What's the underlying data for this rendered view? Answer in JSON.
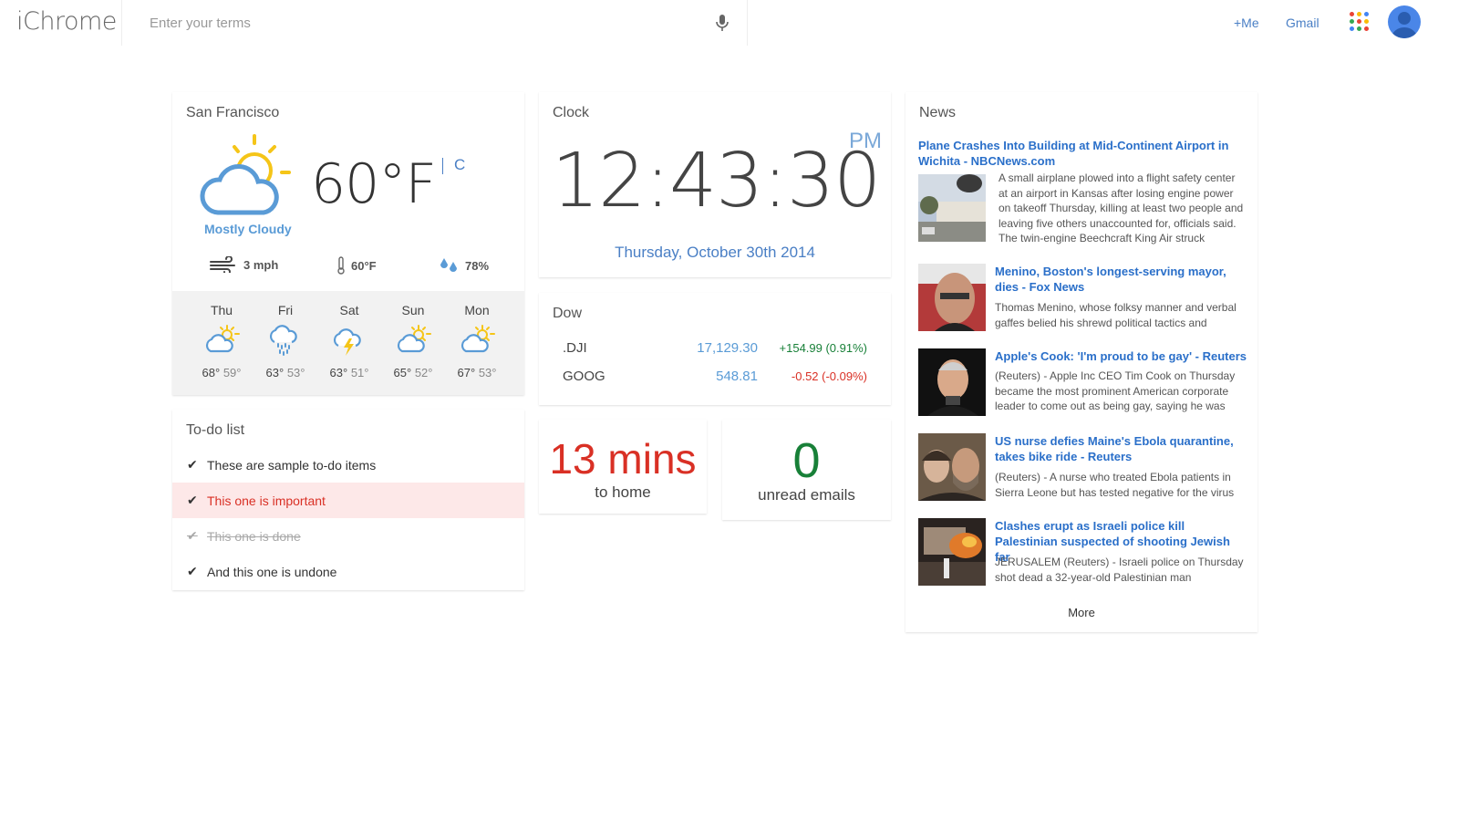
{
  "header": {
    "logo": "iChrome",
    "search_placeholder": "Enter your terms",
    "plus_me": "+Me",
    "gmail": "Gmail"
  },
  "weather": {
    "title": "San Francisco",
    "temp": "60°F",
    "alt_unit": "C",
    "condition": "Mostly Cloudy",
    "wind": "3 mph",
    "feels": "60°F",
    "humidity": "78%",
    "forecast": [
      {
        "day": "Thu",
        "high": "68°",
        "low": "59°",
        "icon": "partly-cloudy-icon"
      },
      {
        "day": "Fri",
        "high": "63°",
        "low": "53°",
        "icon": "rain-icon"
      },
      {
        "day": "Sat",
        "high": "63°",
        "low": "51°",
        "icon": "thunderstorm-icon"
      },
      {
        "day": "Sun",
        "high": "65°",
        "low": "52°",
        "icon": "partly-cloudy-icon"
      },
      {
        "day": "Mon",
        "high": "67°",
        "low": "53°",
        "icon": "partly-cloudy-icon"
      }
    ]
  },
  "todo": {
    "title": "To-do list",
    "items": [
      {
        "text": "These are sample to-do items",
        "state": "normal"
      },
      {
        "text": "This one is important",
        "state": "important"
      },
      {
        "text": "This one is done",
        "state": "done"
      },
      {
        "text": "And this one is undone",
        "state": "normal"
      }
    ]
  },
  "clock": {
    "title": "Clock",
    "time": "12:43:30",
    "ampm": "PM",
    "date": "Thursday, October 30th 2014"
  },
  "stocks": {
    "title": "Dow",
    "rows": [
      {
        "symbol": ".DJI",
        "price": "17,129.30",
        "change": "+154.99 (0.91%)",
        "direction": "up"
      },
      {
        "symbol": "GOOG",
        "price": "548.81",
        "change": "-0.52 (-0.09%)",
        "direction": "down"
      }
    ]
  },
  "traffic": {
    "value": "13 mins",
    "label": "to home"
  },
  "email": {
    "value": "0",
    "label": "unread emails"
  },
  "news": {
    "title": "News",
    "more": "More",
    "items": [
      {
        "title": "Plane Crashes Into Building at Mid-Continent Airport in Wichita - NBCNews.com",
        "snippet": "A small airplane plowed into a flight safety center at an airport in Kansas after losing engine power on takeoff Thursday, killing at least two people and leaving five others unaccounted for, officials said. The twin-engine Beechcraft King Air struck"
      },
      {
        "title": "Menino, Boston's longest-serving mayor, dies - Fox News",
        "snippet": "Thomas Menino, whose folksy manner and verbal gaffes belied his shrewd political tactics and"
      },
      {
        "title": "Apple's Cook: 'I'm proud to be gay' - Reuters",
        "snippet": "(Reuters) - Apple Inc CEO Tim Cook on Thursday became the most prominent American corporate leader to come out as being gay, saying he was"
      },
      {
        "title": "US nurse defies Maine's Ebola quarantine, takes bike ride - Reuters",
        "snippet": "(Reuters) - A nurse who treated Ebola patients in Sierra Leone but has tested negative for the virus"
      },
      {
        "title": "Clashes erupt as Israeli police kill Palestinian suspected of shooting Jewish far",
        "snippet": "JERUSALEM (Reuters) - Israeli police on Thursday shot dead a 32-year-old Palestinian man"
      }
    ]
  },
  "colors": {
    "accent": "#4a7fc5",
    "sun": "#f5c518",
    "cloud": "#5a9bd6",
    "traffic": "#d93025",
    "email": "#188038"
  }
}
